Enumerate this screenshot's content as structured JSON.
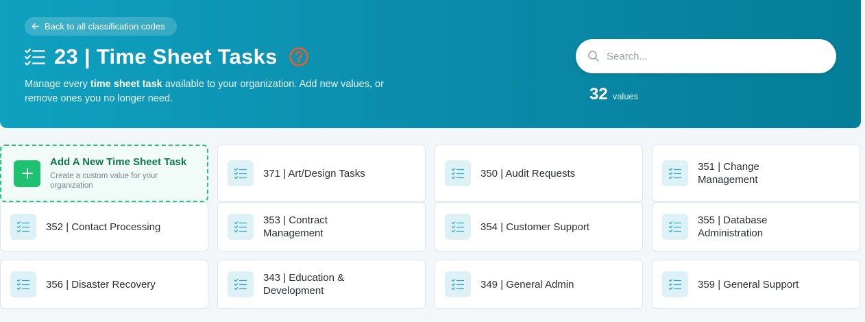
{
  "header": {
    "back_label": "Back to all classification codes",
    "title": "23 | Time Sheet Tasks",
    "description_prefix": "Manage every ",
    "description_bold": "time sheet task",
    "description_suffix": " available to your organization. Add new values, or remove ones you no longer need.",
    "search_placeholder": "Search...",
    "count_value": "32",
    "count_label": "values",
    "icons": {
      "title": "checklist-icon",
      "help": "help-icon",
      "back": "arrow-left-icon",
      "search": "search-icon"
    }
  },
  "add_card": {
    "title": "Add A New Time Sheet Task",
    "subtitle": "Create a custom value for your organization"
  },
  "tasks": [
    {
      "label": "371 | Art/Design Tasks"
    },
    {
      "label": "350 | Audit Requests"
    },
    {
      "label": "351 | Change Management"
    },
    {
      "label": "352 | Contact Processing"
    },
    {
      "label": "353 | Contract Management"
    },
    {
      "label": "354 | Customer Support"
    },
    {
      "label": "355 | Database Administration"
    },
    {
      "label": "356 | Disaster Recovery"
    },
    {
      "label": "343 | Education & Development"
    },
    {
      "label": "349 | General Admin"
    },
    {
      "label": "359 | General Support"
    }
  ],
  "colors": {
    "hero_start": "#0fa1c0",
    "hero_end": "#057e98",
    "accent_green": "#1ec16f",
    "help_icon": "#d3633b",
    "card_icon_bg": "#def1f7"
  }
}
